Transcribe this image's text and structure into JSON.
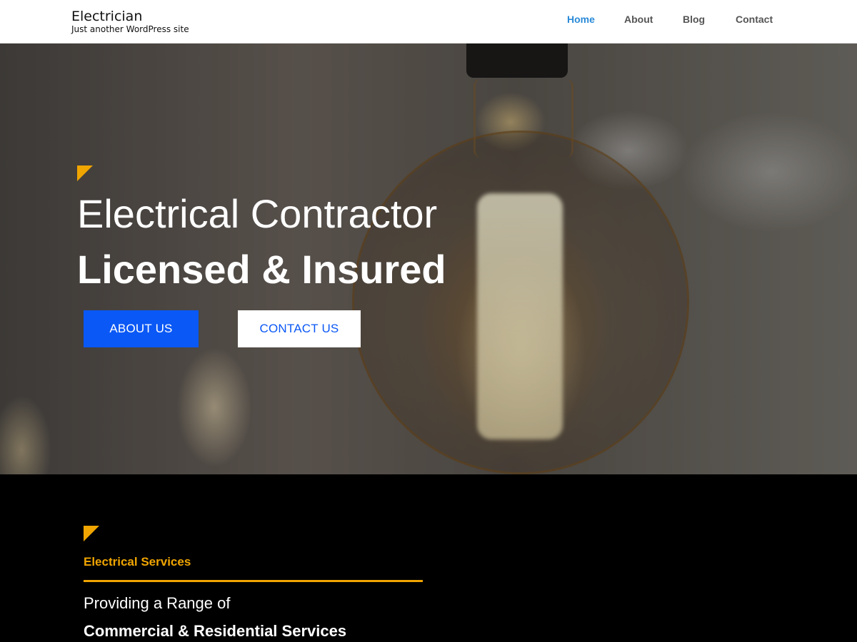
{
  "header": {
    "site_title": "Electrician",
    "tagline": "Just another WordPress site",
    "nav": [
      {
        "label": "Home",
        "active": true
      },
      {
        "label": "About",
        "active": false
      },
      {
        "label": "Blog",
        "active": false
      },
      {
        "label": "Contact",
        "active": false
      }
    ]
  },
  "hero": {
    "title_line1": "Electrical Contractor",
    "title_line2": "Licensed & Insured",
    "about_button": "ABOUT US",
    "contact_button": "CONTACT US",
    "background_image": "lightbulb-photo"
  },
  "services": {
    "label": "Electrical Services",
    "line1": "Providing a Range of",
    "line2": "Commercial & Residential Services"
  },
  "colors": {
    "accent": "#f0a500",
    "primary_blue": "#0a58f5",
    "nav_active": "#2a8ad8",
    "dark_section": "#000000"
  }
}
